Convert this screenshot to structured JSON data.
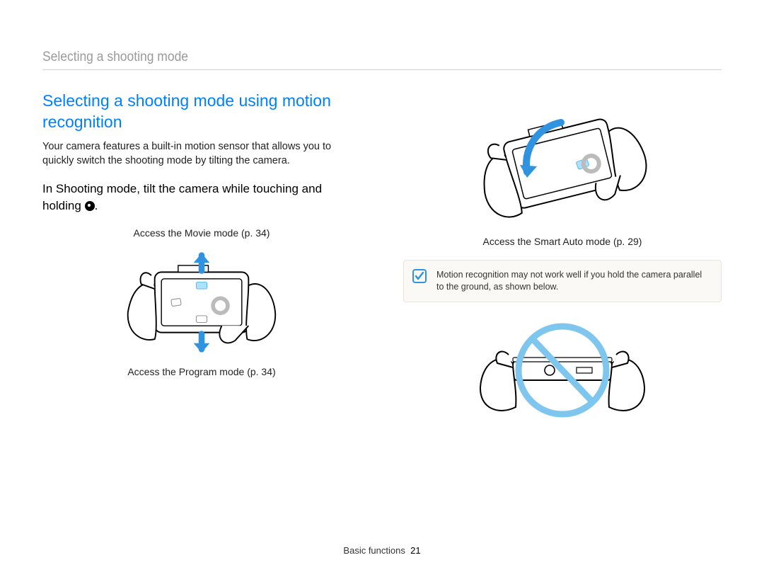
{
  "running_header": "Selecting a shooting mode",
  "section_title": "Selecting a shooting mode using motion recognition",
  "intro": "Your camera features a built-in motion sensor that allows you to quickly switch the shooting mode by tilting the camera.",
  "instruction_pre": "In Shooting mode, tilt the camera while touching and holding ",
  "instruction_post": ".",
  "captions": {
    "movie": "Access the Movie mode (p. 34)",
    "program": "Access the Program mode (p. 34)",
    "smart_auto": "Access the Smart Auto mode (p. 29)"
  },
  "note": "Motion recognition may not work well if you hold the camera parallel to the ground, as shown below.",
  "footer_section": "Basic functions",
  "footer_page": "21"
}
